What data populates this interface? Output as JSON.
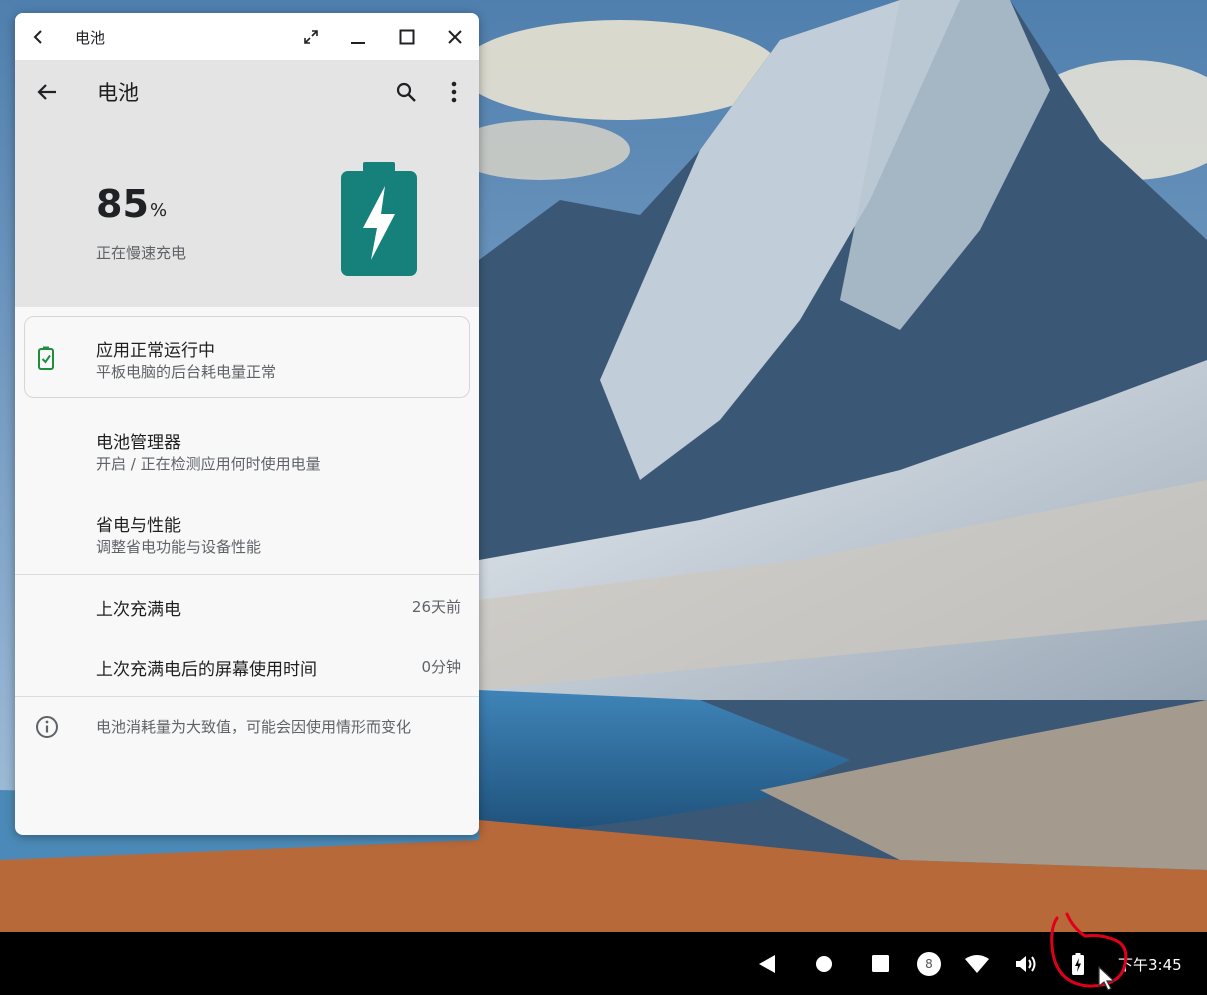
{
  "window": {
    "title": "电池"
  },
  "appbar": {
    "title": "电池"
  },
  "battery": {
    "percent_value": "85",
    "percent_unit": "%",
    "status": "正在慢速充电",
    "level": 0.85,
    "color": "#16807a"
  },
  "status_card": {
    "title": "应用正常运行中",
    "subtitle": "平板电脑的后台耗电量正常",
    "icon": "battery-check-icon",
    "icon_color": "#1e8e3e"
  },
  "menu": [
    {
      "title": "电池管理器",
      "subtitle": "开启 / 正在检测应用何时使用电量"
    },
    {
      "title": "省电与性能",
      "subtitle": "调整省电功能与设备性能"
    }
  ],
  "stats": [
    {
      "label": "上次充满电",
      "value": "26天前"
    },
    {
      "label": "上次充满电后的屏幕使用时间",
      "value": "0分钟"
    }
  ],
  "footer": {
    "note": "电池消耗量为大致值，可能会因使用情形而变化",
    "icon": "info-icon"
  },
  "taskbar": {
    "notification_count": "8",
    "clock": "下午3:45",
    "icons": [
      "back-icon",
      "home-icon",
      "recents-icon",
      "notification-badge",
      "wifi-icon",
      "volume-icon",
      "battery-charging-icon"
    ]
  },
  "colors": {
    "accent": "#16807a",
    "header_bg": "#e4e4e4",
    "taskbar_bg": "#000000",
    "annotation": "#e0001b"
  }
}
